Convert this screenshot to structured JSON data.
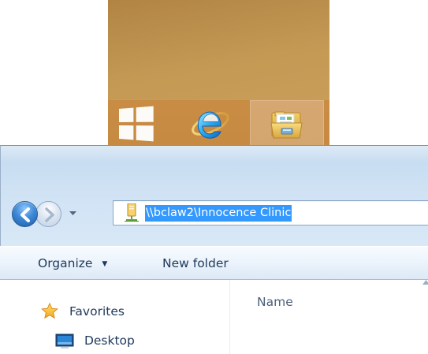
{
  "taskbar": {
    "items": [
      {
        "name": "start-button",
        "icon": "windows-logo-icon"
      },
      {
        "name": "internet-explorer-button",
        "icon": "internet-explorer-icon"
      },
      {
        "name": "file-explorer-button",
        "icon": "file-explorer-icon",
        "active": true
      }
    ],
    "colors": {
      "wallpaper": "#c39954",
      "taskbar": "#c98c44"
    }
  },
  "explorer": {
    "navigation": {
      "back_icon": "back-arrow-icon",
      "forward_icon": "forward-arrow-icon",
      "recent_icon": "chevron-down-icon"
    },
    "address_bar": {
      "path": "\\\\bclaw2\\Innocence Clinic",
      "icon": "network-folder-icon",
      "selected": true
    },
    "command_bar": {
      "organize_label": "Organize",
      "organize_arrow": "▼",
      "new_folder_label": "New folder"
    },
    "navigation_pane": {
      "favorites_label": "Favorites",
      "desktop_label": "Desktop"
    },
    "file_list": {
      "name_column_label": "Name"
    },
    "colors": {
      "selection": "#3399ff",
      "text": "#1e395b",
      "frame": "#cfe2f4"
    }
  }
}
